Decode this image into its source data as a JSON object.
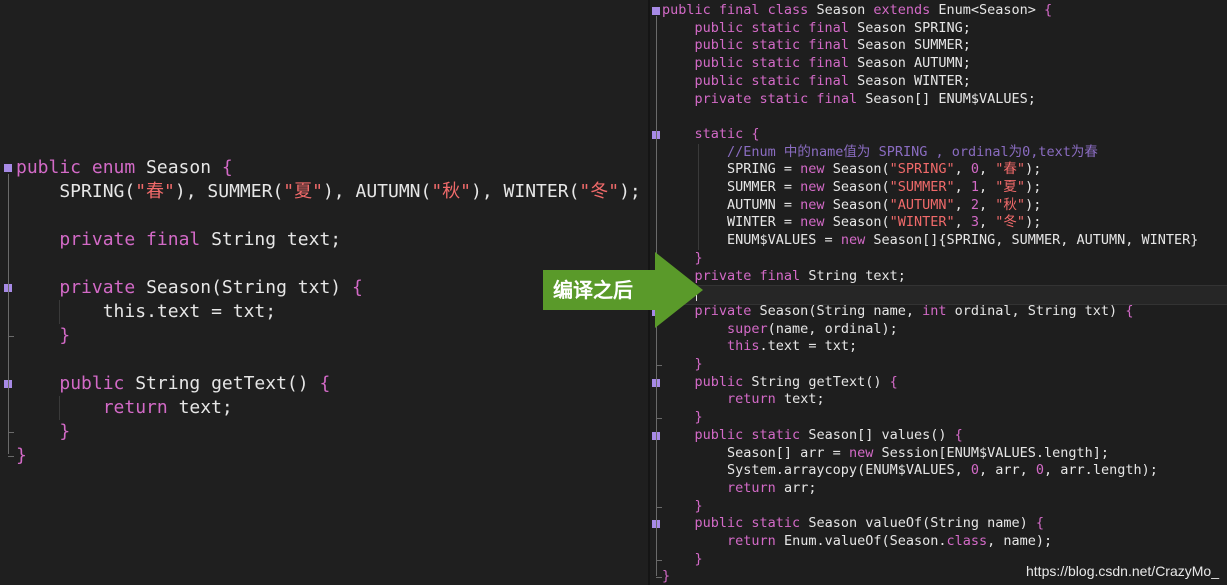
{
  "left_code": [
    [
      [
        "public ",
        "kw"
      ],
      [
        "enum ",
        "kw"
      ],
      [
        "Season ",
        ""
      ],
      [
        "{",
        "kw"
      ]
    ],
    [
      [
        "    SPRING(",
        ""
      ],
      [
        "\"春\"",
        "str"
      ],
      [
        "), SUMMER(",
        ""
      ],
      [
        "\"夏\"",
        "str"
      ],
      [
        "), AUTUMN(",
        ""
      ],
      [
        "\"秋\"",
        "str"
      ],
      [
        "), WINTER(",
        ""
      ],
      [
        "\"冬\"",
        "str"
      ],
      [
        ");",
        ""
      ]
    ],
    [],
    [
      [
        "    ",
        ""
      ],
      [
        "private final ",
        "kw"
      ],
      [
        "String text;",
        ""
      ]
    ],
    [],
    [
      [
        "    ",
        ""
      ],
      [
        "private ",
        "kw"
      ],
      [
        "Season(String txt) ",
        ""
      ],
      [
        "{",
        "kw"
      ]
    ],
    [
      [
        "        ",
        ""
      ],
      [
        "this",
        ""
      ],
      [
        ".text = txt;",
        ""
      ]
    ],
    [
      [
        "    ",
        ""
      ],
      [
        "}",
        "kw"
      ]
    ],
    [],
    [
      [
        "    ",
        ""
      ],
      [
        "public ",
        "kw"
      ],
      [
        "String getText() ",
        ""
      ],
      [
        "{",
        "kw"
      ]
    ],
    [
      [
        "        ",
        ""
      ],
      [
        "return ",
        "kw"
      ],
      [
        "text;",
        ""
      ]
    ],
    [
      [
        "    ",
        ""
      ],
      [
        "}",
        "kw"
      ]
    ],
    [
      [
        "}",
        "kw"
      ]
    ]
  ],
  "right_code": [
    [
      [
        "public final class ",
        "kw"
      ],
      [
        "Season ",
        ""
      ],
      [
        "extends ",
        "kw"
      ],
      [
        "Enum<Season> ",
        ""
      ],
      [
        "{",
        "kw"
      ]
    ],
    [
      [
        "    ",
        ""
      ],
      [
        "public static final ",
        "kw"
      ],
      [
        "Season SPRING;",
        ""
      ]
    ],
    [
      [
        "    ",
        ""
      ],
      [
        "public static final ",
        "kw"
      ],
      [
        "Season SUMMER;",
        ""
      ]
    ],
    [
      [
        "    ",
        ""
      ],
      [
        "public static final ",
        "kw"
      ],
      [
        "Season AUTUMN;",
        ""
      ]
    ],
    [
      [
        "    ",
        ""
      ],
      [
        "public static final ",
        "kw"
      ],
      [
        "Season WINTER;",
        ""
      ]
    ],
    [
      [
        "    ",
        ""
      ],
      [
        "private static final ",
        "kw"
      ],
      [
        "Season[] ENUM$VALUES;",
        ""
      ]
    ],
    [],
    [
      [
        "    ",
        ""
      ],
      [
        "static ",
        "kw"
      ],
      [
        "{",
        "kw"
      ]
    ],
    [
      [
        "        ",
        ""
      ],
      [
        "//Enum 中的name值为 SPRING , ordinal为0,text为春",
        "cm"
      ]
    ],
    [
      [
        "        SPRING = ",
        ""
      ],
      [
        "new ",
        "kw"
      ],
      [
        "Season(",
        ""
      ],
      [
        "\"SPRING\"",
        "str"
      ],
      [
        ", ",
        ""
      ],
      [
        "0",
        "num"
      ],
      [
        ", ",
        ""
      ],
      [
        "\"春\"",
        "str"
      ],
      [
        ");",
        ""
      ]
    ],
    [
      [
        "        SUMMER = ",
        ""
      ],
      [
        "new ",
        "kw"
      ],
      [
        "Season(",
        ""
      ],
      [
        "\"SUMMER\"",
        "str"
      ],
      [
        ", ",
        ""
      ],
      [
        "1",
        "num"
      ],
      [
        ", ",
        ""
      ],
      [
        "\"夏\"",
        "str"
      ],
      [
        ");",
        ""
      ]
    ],
    [
      [
        "        AUTUMN = ",
        ""
      ],
      [
        "new ",
        "kw"
      ],
      [
        "Season(",
        ""
      ],
      [
        "\"AUTUMN\"",
        "str"
      ],
      [
        ", ",
        ""
      ],
      [
        "2",
        "num"
      ],
      [
        ", ",
        ""
      ],
      [
        "\"秋\"",
        "str"
      ],
      [
        ");",
        ""
      ]
    ],
    [
      [
        "        WINTER = ",
        ""
      ],
      [
        "new ",
        "kw"
      ],
      [
        "Season(",
        ""
      ],
      [
        "\"WINTER\"",
        "str"
      ],
      [
        ", ",
        ""
      ],
      [
        "3",
        "num"
      ],
      [
        ", ",
        ""
      ],
      [
        "\"冬\"",
        "str"
      ],
      [
        ");",
        ""
      ]
    ],
    [
      [
        "        ENUM$VALUES = ",
        ""
      ],
      [
        "new ",
        "kw"
      ],
      [
        "Season[]{SPRING, SUMMER, AUTUMN, WINTER}",
        ""
      ]
    ],
    [
      [
        "    ",
        ""
      ],
      [
        "}",
        "kw"
      ]
    ],
    [
      [
        "    ",
        ""
      ],
      [
        "private final ",
        "kw"
      ],
      [
        "String text;",
        ""
      ]
    ],
    [],
    [
      [
        "    ",
        ""
      ],
      [
        "private ",
        "kw"
      ],
      [
        "Season(String name, ",
        ""
      ],
      [
        "int ",
        "kw"
      ],
      [
        "ordinal, String txt) ",
        ""
      ],
      [
        "{",
        "kw"
      ]
    ],
    [
      [
        "        ",
        ""
      ],
      [
        "super",
        "kw"
      ],
      [
        "(name, ordinal);",
        ""
      ]
    ],
    [
      [
        "        ",
        ""
      ],
      [
        "this",
        "kw"
      ],
      [
        ".text = txt;",
        ""
      ]
    ],
    [
      [
        "    ",
        ""
      ],
      [
        "}",
        "kw"
      ]
    ],
    [
      [
        "    ",
        ""
      ],
      [
        "public ",
        "kw"
      ],
      [
        "String getText() ",
        ""
      ],
      [
        "{",
        "kw"
      ]
    ],
    [
      [
        "        ",
        ""
      ],
      [
        "return ",
        "kw"
      ],
      [
        "text;",
        ""
      ]
    ],
    [
      [
        "    ",
        ""
      ],
      [
        "}",
        "kw"
      ]
    ],
    [
      [
        "    ",
        ""
      ],
      [
        "public static ",
        "kw"
      ],
      [
        "Season[] values() ",
        ""
      ],
      [
        "{",
        "kw"
      ]
    ],
    [
      [
        "        Season[] arr = ",
        ""
      ],
      [
        "new ",
        "kw"
      ],
      [
        "Session[ENUM$VALUES.length];",
        ""
      ]
    ],
    [
      [
        "        System.arraycopy(ENUM$VALUES, ",
        ""
      ],
      [
        "0",
        "num"
      ],
      [
        ", arr, ",
        ""
      ],
      [
        "0",
        "num"
      ],
      [
        ", arr.length);",
        ""
      ]
    ],
    [
      [
        "        ",
        ""
      ],
      [
        "return ",
        "kw"
      ],
      [
        "arr;",
        ""
      ]
    ],
    [
      [
        "    ",
        ""
      ],
      [
        "}",
        "kw"
      ]
    ],
    [
      [
        "    ",
        ""
      ],
      [
        "public static ",
        "kw"
      ],
      [
        "Season valueOf(String name) ",
        ""
      ],
      [
        "{",
        "kw"
      ]
    ],
    [
      [
        "        ",
        ""
      ],
      [
        "return ",
        "kw"
      ],
      [
        "Enum.valueOf(Season.",
        ""
      ],
      [
        "class",
        "kw"
      ],
      [
        ", name);",
        ""
      ]
    ],
    [
      [
        "    ",
        ""
      ],
      [
        "}",
        "kw"
      ]
    ],
    [
      [
        "}",
        "kw"
      ]
    ]
  ],
  "callout": {
    "label": "编译之后",
    "color": "#5a9a2a"
  },
  "watermark": "https://blog.csdn.net/CrazyMo_",
  "colors": {
    "keyword": "#d36ac7",
    "string": "#f06a6a",
    "comment": "#8a6cc1",
    "text": "#e6e6e6",
    "fold_marker": "#a78ae6"
  }
}
